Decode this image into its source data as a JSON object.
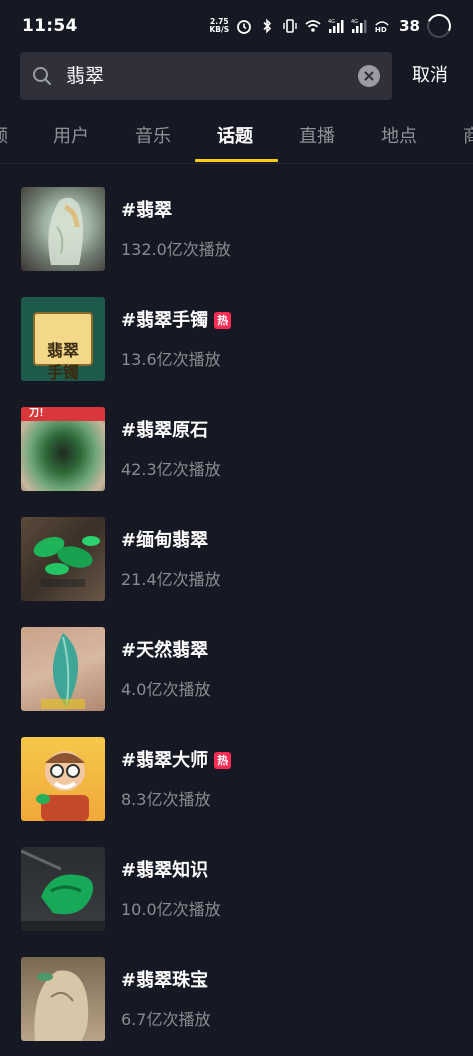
{
  "status_bar": {
    "time": "11:54",
    "speed_value": "2.75",
    "speed_unit": "KB/S",
    "battery": "38",
    "icons": [
      "alarm-icon",
      "bluetooth-icon",
      "vibrate-icon",
      "wifi-icon",
      "signal-4g-icon",
      "signal-4g-icon",
      "hd-icon",
      "battery-ring-icon"
    ]
  },
  "search": {
    "query": "翡翠",
    "cancel_label": "取消"
  },
  "tabs": [
    {
      "label": "频",
      "active": false
    },
    {
      "label": "用户",
      "active": false
    },
    {
      "label": "音乐",
      "active": false
    },
    {
      "label": "话题",
      "active": true
    },
    {
      "label": "直播",
      "active": false
    },
    {
      "label": "地点",
      "active": false
    },
    {
      "label": "商",
      "active": false
    }
  ],
  "colors": {
    "background": "#161823",
    "accent": "#face15",
    "hot_badge": "#fe2c55",
    "secondary_text": "#8a8b92"
  },
  "hot_badge_label": "热",
  "topics": [
    {
      "title": "#翡翠",
      "plays": "132.0亿次播放",
      "hot": false,
      "thumb_text": ""
    },
    {
      "title": "#翡翠手镯",
      "plays": "13.6亿次播放",
      "hot": true,
      "thumb_text": "翡翠\n手镯"
    },
    {
      "title": "#翡翠原石",
      "plays": "42.3亿次播放",
      "hot": false,
      "thumb_text": "刀！"
    },
    {
      "title": "#缅甸翡翠",
      "plays": "21.4亿次播放",
      "hot": false,
      "thumb_text": ""
    },
    {
      "title": "#天然翡翠",
      "plays": "4.0亿次播放",
      "hot": false,
      "thumb_text": ""
    },
    {
      "title": "#翡翠大师",
      "plays": "8.3亿次播放",
      "hot": true,
      "thumb_text": ""
    },
    {
      "title": "#翡翠知识",
      "plays": "10.0亿次播放",
      "hot": false,
      "thumb_text": ""
    },
    {
      "title": "#翡翠珠宝",
      "plays": "6.7亿次播放",
      "hot": false,
      "thumb_text": ""
    }
  ]
}
